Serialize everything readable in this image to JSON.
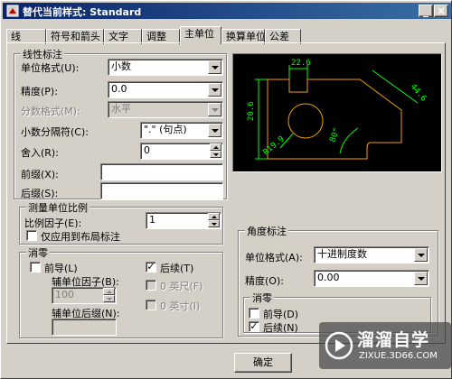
{
  "window": {
    "title": "替代当前样式: Standard",
    "min_glyph": "_",
    "close_glyph": "×"
  },
  "tabs": [
    {
      "label": "线",
      "active": false
    },
    {
      "label": "符号和箭头",
      "active": false
    },
    {
      "label": "文字",
      "active": false
    },
    {
      "label": "调整",
      "active": false
    },
    {
      "label": "主单位",
      "active": true
    },
    {
      "label": "换算单位",
      "active": false
    },
    {
      "label": "公差",
      "active": false
    }
  ],
  "linear": {
    "legend": "线性标注",
    "unit_format_label": "单位格式(U):",
    "unit_format_value": "小数",
    "precision_label": "精度(P):",
    "precision_value": "0.0",
    "fraction_format_label": "分数格式(M):",
    "fraction_format_value": "水平",
    "decimal_sep_label": "小数分隔符(C):",
    "decimal_sep_value": "\".\" (句点)",
    "round_label": "舍入(R):",
    "round_value": "0",
    "prefix_label": "前缀(X):",
    "prefix_value": "",
    "suffix_label": "后缀(S):",
    "suffix_value": ""
  },
  "scale": {
    "legend": "测量单位比例",
    "factor_label": "比例因子(E):",
    "factor_value": "1",
    "layout_only_label": "仅应用到布局标注",
    "layout_only_checked": false
  },
  "zero_linear": {
    "legend": "消零",
    "leading_label": "前导(L)",
    "leading_checked": false,
    "trailing_label": "后续(T)",
    "trailing_checked": true,
    "sub_factor_label": "辅单位因子(B):",
    "sub_factor_value": "100",
    "feet_label": "0 英尺(F)",
    "sub_suffix_label": "辅单位后缀(N):",
    "sub_suffix_value": "",
    "inches_label": "0 英寸(I)"
  },
  "angular": {
    "legend": "角度标注",
    "unit_format_label": "单位格式(A):",
    "unit_format_value": "十进制度数",
    "precision_label": "精度(O):",
    "precision_value": "0.00"
  },
  "zero_angular": {
    "legend": "消零",
    "leading_label": "前导(D)",
    "leading_checked": false,
    "trailing_label": "后续(N)",
    "trailing_checked": true
  },
  "preview": {
    "dim_top": "22.6",
    "dim_left": "20.6",
    "dim_right": "44.6",
    "dim_angle": "80°",
    "dim_radius": "R19.9"
  },
  "buttons": {
    "ok": "确定"
  },
  "watermark": {
    "name": "溜溜自学",
    "url": "ZIXUE.3D66.COM"
  },
  "colors": {
    "title_start": "#0a246a",
    "title_end": "#3a6ea5",
    "face": "#d4d0c8",
    "preview_bg": "#000000",
    "geometry": "#f0a000",
    "dimension": "#00ff00"
  },
  "icons": {
    "app": "dimension-style-icon",
    "minimize": "minimize-icon",
    "close": "close-icon",
    "watermark": "play-logo-icon"
  }
}
